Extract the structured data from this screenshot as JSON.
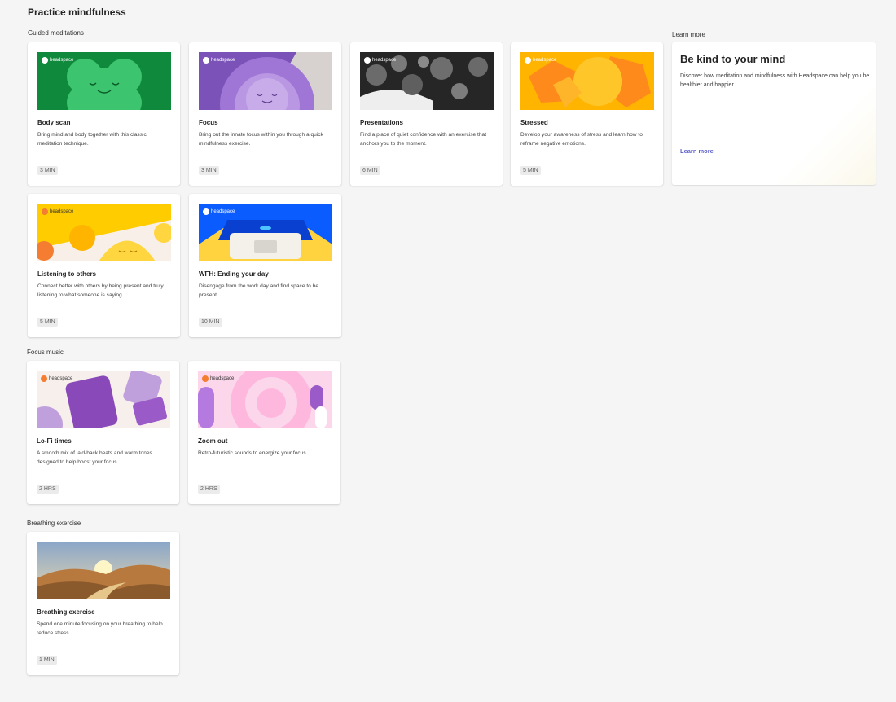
{
  "page": {
    "title": "Practice mindfulness"
  },
  "sections": {
    "guided": "Guided meditations",
    "learn_more": "Learn more",
    "focus_music": "Focus music",
    "breathing": "Breathing exercise"
  },
  "brand_label": "headspace",
  "cards": {
    "body_scan": {
      "title": "Body scan",
      "desc": "Bring mind and body together with this classic meditation technique.",
      "duration": "3 MIN"
    },
    "focus": {
      "title": "Focus",
      "desc": "Bring out the innate focus within you through a quick mindfulness exercise.",
      "duration": "3 MIN"
    },
    "presentations": {
      "title": "Presentations",
      "desc": "Find a place of quiet confidence with an exercise that anchors you to the moment.",
      "duration": "6 MIN"
    },
    "stressed": {
      "title": "Stressed",
      "desc": "Develop your awareness of stress and learn how to reframe negative emotions.",
      "duration": "5 MIN"
    },
    "listening": {
      "title": "Listening to others",
      "desc": "Connect better with others by being present and truly listening to what someone is saying.",
      "duration": "5 MIN"
    },
    "wfh": {
      "title": "WFH: Ending your day",
      "desc": "Disengage from the work day and find space to be present.",
      "duration": "10 MIN"
    },
    "lofi": {
      "title": "Lo-Fi times",
      "desc": "A smooth mix of laid-back beats and warm tones designed to help boost your focus.",
      "duration": "2 HRS"
    },
    "zoom_out": {
      "title": "Zoom out",
      "desc": "Retro-futuristic sounds to energize your focus.",
      "duration": "2 HRS"
    },
    "breathing": {
      "title": "Breathing exercise",
      "desc": "Spend one minute focusing on your breathing to help reduce stress.",
      "duration": "1 MIN"
    }
  },
  "promo": {
    "heading": "Be kind to your mind",
    "text": "Discover how meditation and mindfulness with Headspace can help you be healthier and happier.",
    "link": "Learn more"
  },
  "colors": {
    "background": "#f5f5f5",
    "link": "#5b5fc7",
    "brand_orange": "#f47d31"
  }
}
